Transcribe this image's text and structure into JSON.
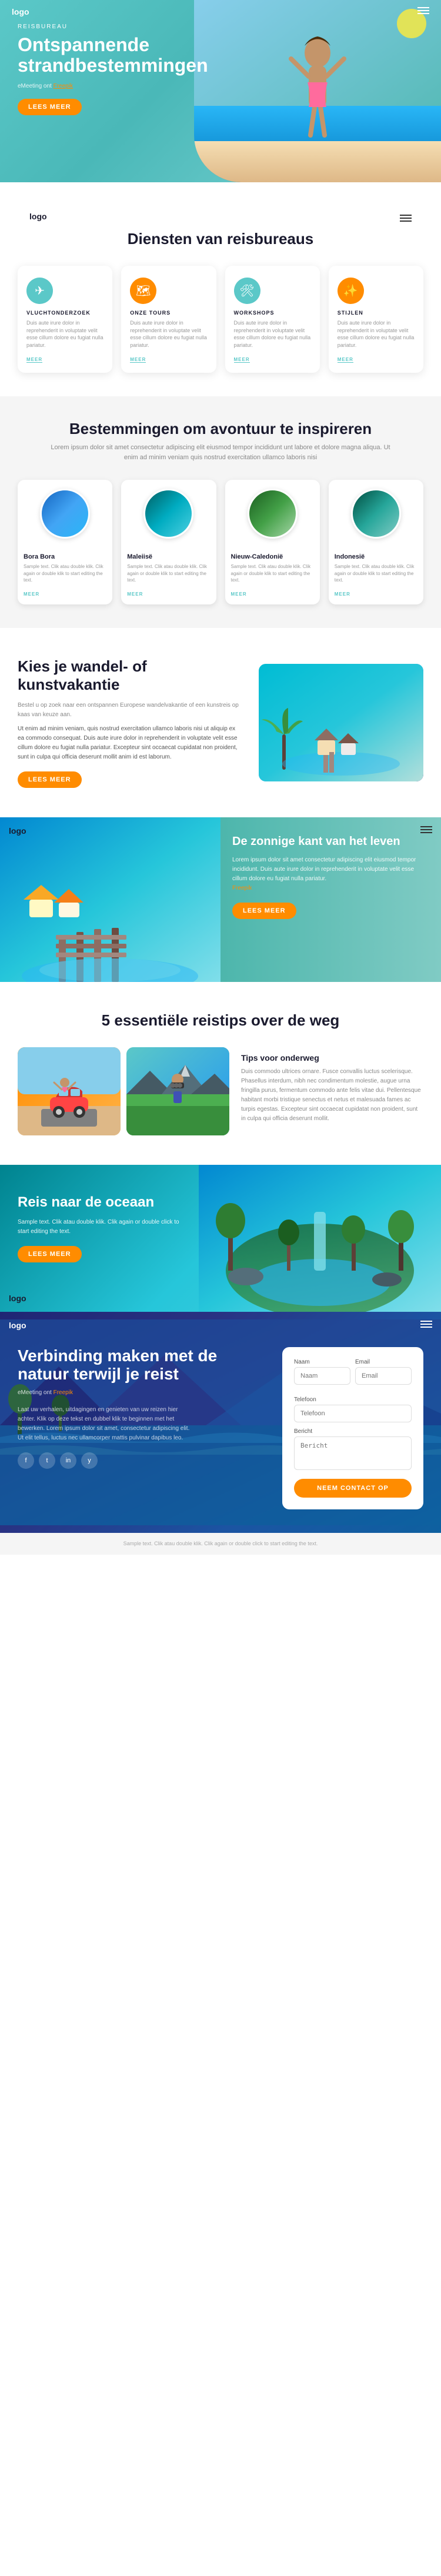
{
  "hero": {
    "logo": "logo",
    "label": "REISBUREAU",
    "title": "Ontspannende strandbestemmingen",
    "subtitle_text": "eMeeting ont ",
    "subtitle_link": "Freepik",
    "btn_label": "LEES MEER"
  },
  "services": {
    "logo": "logo",
    "title": "Diensten van reisbureaus",
    "cards": [
      {
        "id": "vluchten",
        "title": "VLUCHTONDERZOEK",
        "text": "Duis aute irure dolor in reprehenderit in voluptate velit esse cillum dolore eu fugiat nulla pariatur.",
        "link": "MEER",
        "icon": "✈"
      },
      {
        "id": "tours",
        "title": "ONZE TOURS",
        "text": "Duis aute irure dolor in reprehenderit in voluptate velit esse cillum dolore eu fugiat nulla pariatur.",
        "link": "MEER",
        "icon": "🗺"
      },
      {
        "id": "workshops",
        "title": "WORKSHOPS",
        "text": "Duis aute irure dolor in reprehenderit in voluptate velit esse cillum dolore eu fugiat nulla pariatur.",
        "link": "MEER",
        "icon": "🛠"
      },
      {
        "id": "stijlen",
        "title": "STIJLEN",
        "text": "Duis aute irure dolor in reprehenderit in voluptate velit esse cillum dolore eu fugiat nulla pariatur.",
        "link": "MEER",
        "icon": "✨"
      }
    ]
  },
  "destinations": {
    "title": "Bestemmingen om avontuur te inspireren",
    "desc": "Lorem ipsum dolor sit amet consectetur adipiscing elit eiusmod tempor incididunt unt labore et dolore magna aliqua. Ut enim ad minim veniam quis nostrud exercitation ullamco laboris nisi",
    "items": [
      {
        "name": "Bora Bora",
        "text": "Sample text. Clik atau double klik. Clik again or double klik to start editing the text.",
        "link": "MEER"
      },
      {
        "name": "Maleiisë",
        "text": "Sample text. Clik atau double klik. Clik again or double klik to start editing the text.",
        "link": "MEER"
      },
      {
        "name": "Nieuw-Caledonië",
        "text": "Sample text. Clik atau double klik. Clik again or double klik to start editing the text.",
        "link": "MEER"
      },
      {
        "name": "Indonesië",
        "text": "Sample text. Clik atau double klik. Clik again or double klik to start editing the text.",
        "link": "MEER"
      }
    ]
  },
  "art_vacation": {
    "title": "Kies je wandel- of kunstvakantie",
    "desc": "Bestel u op zoek naar een ontspannen Europese wandelvakantie of een kunstreis op kaas van keuze aan.",
    "desc2": "Ut enim ad minim veniam, quis nostrud exercitation ullamco laboris nisi ut aliquip ex ea commodo consequat. Duis aute irure dolor in reprehenderit in voluptate velit esse cillum dolore eu fugiat nulla pariatur. Excepteur sint occaecat cupidatat non proident, sunt in culpa qui officia deserunt mollit anim id est laborum.",
    "btn_label": "LEES MEER"
  },
  "zonnige": {
    "logo": "logo",
    "title": "De zonnige kant van het leven",
    "text": "Lorem ipsum dolor sit amet consectetur adipiscing elit eiusmod tempor incididunt. Duis aute irure dolor in reprehenderit in voluptate velit esse cillum dolore eu fugiat nulla pariatur.",
    "link_text": "Freepik",
    "btn_label": "LEES MEER"
  },
  "tips": {
    "title": "5 essentiële reistips over de weg",
    "text_title": "Tips voor onderweg",
    "text_desc": "Duis commodo ultrices ornare. Fusce convallis luctus scelerisque. Phasellus interdum, nibh nec condimentum molestie, augue urna fringilla purus, fermentum commodo ante felis vitae dui. Pellentesque habitant morbi tristique senectus et netus et malesuada fames ac turpis egestas. Excepteur sint occaecat cupidatat non proident, sunt in culpa qui officia deserunt mollit."
  },
  "ocean": {
    "logo": "logo",
    "title": "Reis naar de oceaan",
    "desc": "Sample text. Clik atau double klik. Clik again or double click to start editing the text.",
    "btn_label": "LEES MEER"
  },
  "footer_hero": {
    "logo": "logo",
    "title": "Verbinding maken met de natuur terwijl je reist",
    "subtitle_text": "eMeeting ont ",
    "subtitle_link": "Freepik",
    "desc": "Laat uw verhalen, uitdagingen en genieten van uw reizen hier achter. Klik op deze tekst en dubbel klik te beginnen met het bewerken. Lorem ipsum dolor sit amet, consectetur adipiscing elit. Ut elit tellus, luctus nec ullamcorper mattis pulvinar dapibus leo.",
    "social": [
      "f",
      "t",
      "in",
      "y"
    ],
    "form": {
      "name_label": "Naam",
      "name_placeholder": "Naam",
      "email_label": "Email",
      "email_placeholder": "Email",
      "phone_label": "Telefoon",
      "phone_placeholder": "Telefoon",
      "message_label": "Bericht",
      "message_placeholder": "Bericht",
      "submit_label": "NEEM CONTACT OP"
    }
  },
  "footer_bottom": {
    "text": "Sample text. Clik atau double klik. Clik again or double click to start editing the text."
  }
}
